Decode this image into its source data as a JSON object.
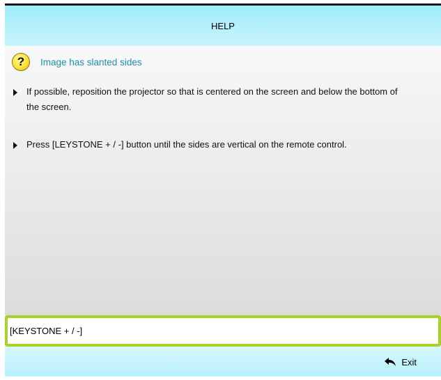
{
  "header": {
    "title": "HELP"
  },
  "topic": {
    "icon": "question-mark-icon",
    "title": "Image has slanted sides"
  },
  "instructions": [
    {
      "text": "If possible, reposition the projector so that is centered on the screen and below the bottom of the  screen."
    },
    {
      "text": "Press [LEYSTONE + / -] button until the sides are vertical on the remote control."
    }
  ],
  "footer": {
    "selected_item": "[KEYSTONE + / -]",
    "exit_label": "Exit",
    "exit_icon": "back-arrow-icon"
  },
  "colors": {
    "title_bar": "#b7f1fb",
    "topic_text": "#1f8fa6",
    "selection_border": "#a8d12a",
    "help_icon": "#ffe23a"
  }
}
